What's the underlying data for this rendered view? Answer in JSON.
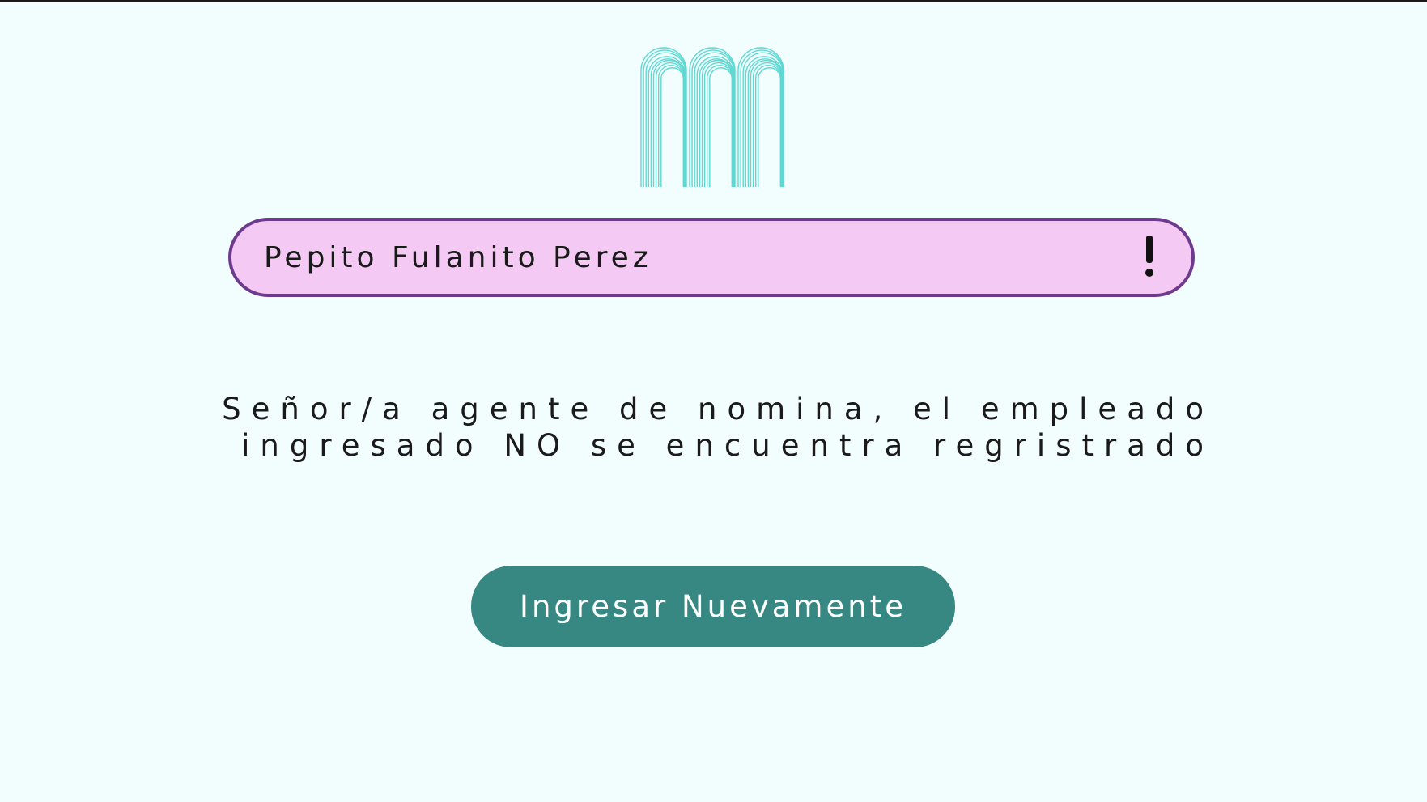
{
  "employee_field": {
    "value": "Pepito Fulanito Perez",
    "status_icon": "exclamation-icon"
  },
  "message": {
    "line1": "Señor/a agente de nomina, el empleado",
    "line2": "ingresado NO se encuentra regristrado"
  },
  "retry_button": {
    "label": "Ingresar Nuevamente"
  },
  "colors": {
    "background": "#f2fdfd",
    "field_fill": "#f4c9f4",
    "field_border": "#6e3a8e",
    "button": "#378883",
    "logo": "#5fd8d2"
  },
  "logo": {
    "icon": "arched-m-logo"
  }
}
